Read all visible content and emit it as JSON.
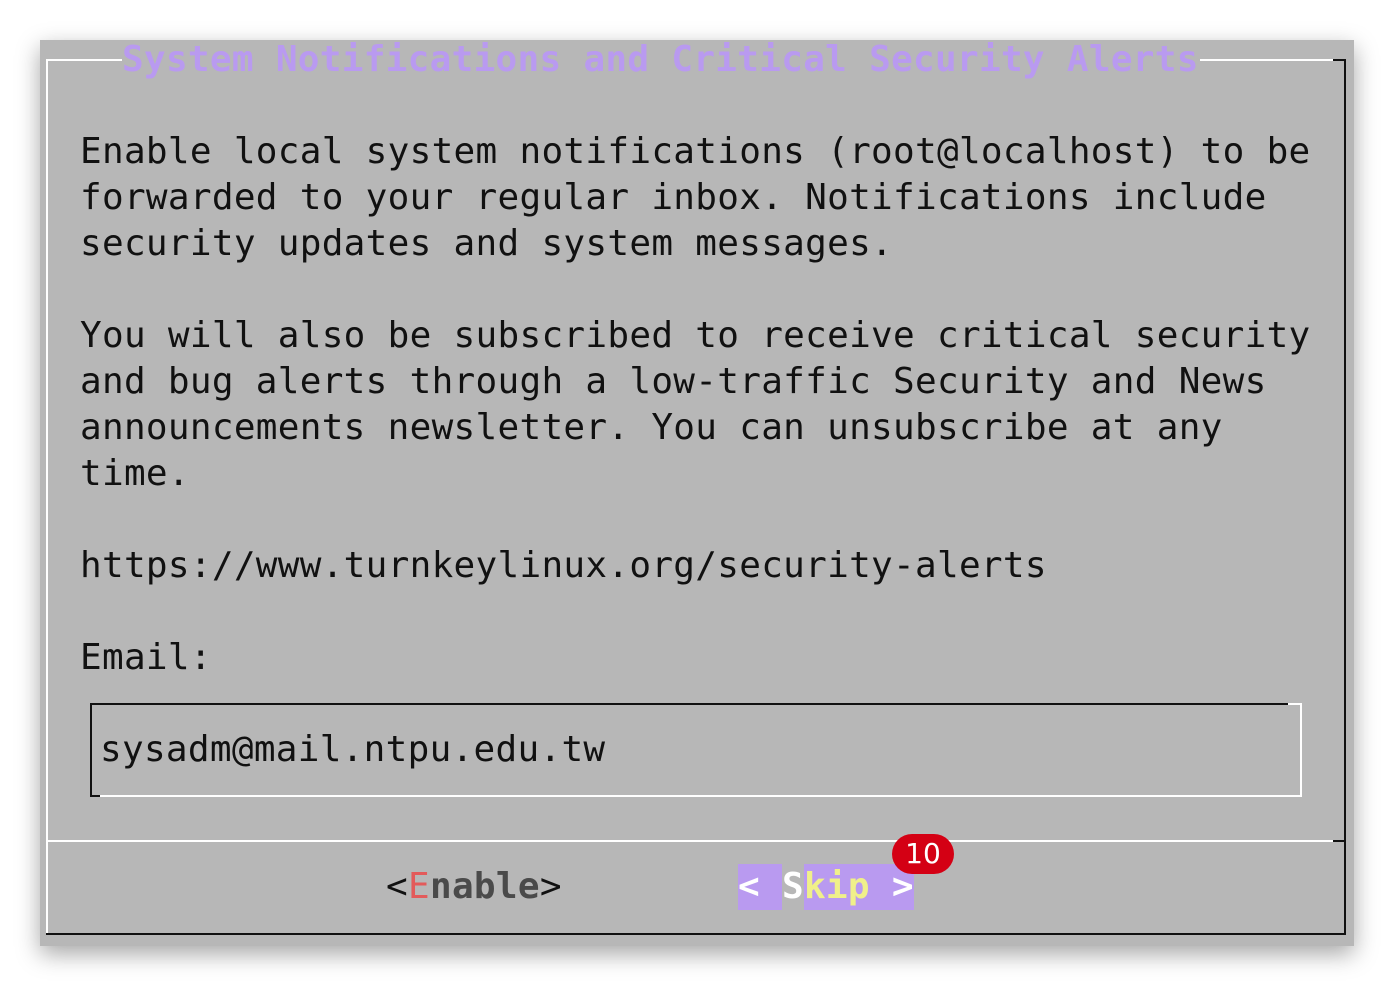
{
  "dialog": {
    "title": "System Notifications and Critical Security Alerts",
    "paragraph1": "Enable local system notifications (root@localhost) to be\nforwarded to your regular inbox. Notifications include\nsecurity updates and system messages.",
    "paragraph2": "You will also be subscribed to receive critical security\nand bug alerts through a low-traffic Security and News\nannouncements newsletter. You can unsubscribe at any\ntime.",
    "url": "https://www.turnkeylinux.org/security-alerts",
    "email_label": "Email:",
    "email_value": "sysadm@mail.ntpu.edu.tw"
  },
  "buttons": {
    "enable": {
      "open": "<",
      "hotkey": "E",
      "rest": "nable",
      "close": ">"
    },
    "skip": {
      "open": "< ",
      "hotkey": "S",
      "rest": "kip",
      "close": " >"
    }
  },
  "badge": {
    "count": "10"
  },
  "colors": {
    "dialog_bg": "#b7b7b7",
    "title": "#b99af0",
    "selected_button_bg": "#b99af0",
    "hotkey": "#e35a5a",
    "badge": "#d40014"
  }
}
